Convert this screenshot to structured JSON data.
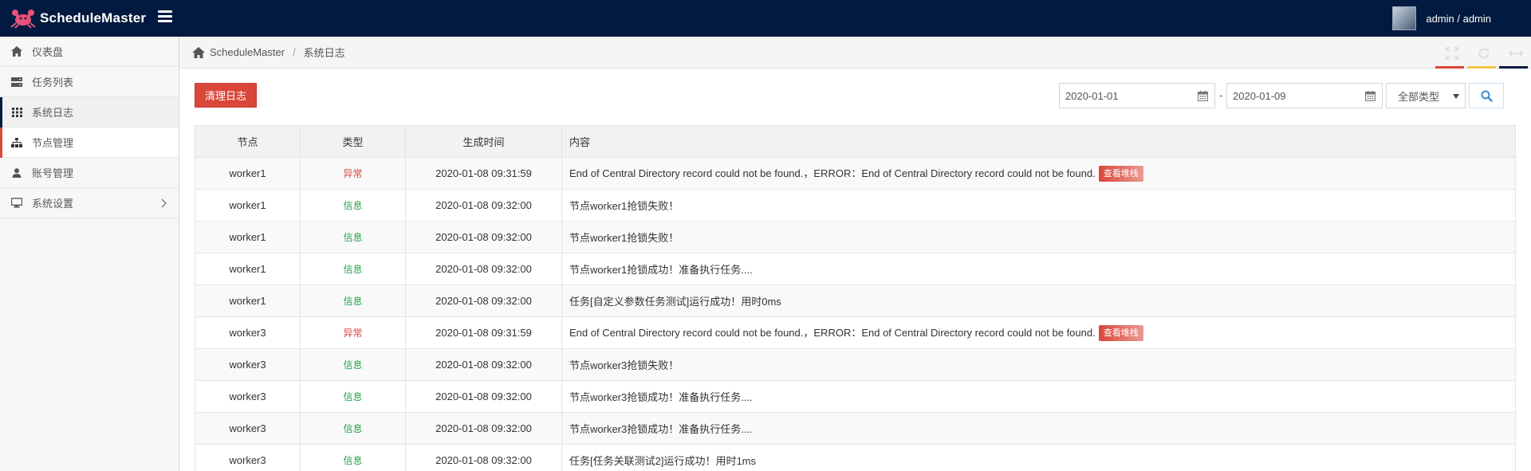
{
  "app": {
    "brand": "ScheduleMaster",
    "user": "admin / admin"
  },
  "colors": {
    "topbar": "#021a40",
    "accent_red": "#d9463a",
    "info_green": "#2aa04a",
    "line_red": "#d9463a",
    "line_yellow": "#f3c64a",
    "line_navy": "#021a40"
  },
  "sidebar": {
    "items": [
      {
        "label": "仪表盘",
        "icon": "home-icon"
      },
      {
        "label": "任务列表",
        "icon": "server-icon"
      },
      {
        "label": "系统日志",
        "icon": "grid-icon"
      },
      {
        "label": "节点管理",
        "icon": "sitemap-icon"
      },
      {
        "label": "账号管理",
        "icon": "user-icon"
      },
      {
        "label": "系统设置",
        "icon": "desktop-icon"
      }
    ]
  },
  "breadcrumb": {
    "root": "ScheduleMaster",
    "separator": "/",
    "current": "系统日志"
  },
  "toolbar": {
    "clear_label": "清理日志"
  },
  "filter": {
    "start_date": "2020-01-01",
    "end_date": "2020-01-09",
    "dash": "-",
    "type_selected": "全部类型"
  },
  "table": {
    "headers": [
      "节点",
      "类型",
      "生成时间",
      "内容"
    ],
    "stack_label": "查看堆栈",
    "rows": [
      {
        "node": "worker1",
        "type": "异常",
        "time": "2020-01-08 09:31:59",
        "content": "End of Central Directory record could not be found.，ERROR：End of Central Directory record could not be found."
      },
      {
        "node": "worker1",
        "type": "信息",
        "time": "2020-01-08 09:32:00",
        "content": "节点worker1抢锁失败！"
      },
      {
        "node": "worker1",
        "type": "信息",
        "time": "2020-01-08 09:32:00",
        "content": "节点worker1抢锁失败！"
      },
      {
        "node": "worker1",
        "type": "信息",
        "time": "2020-01-08 09:32:00",
        "content": "节点worker1抢锁成功！准备执行任务...."
      },
      {
        "node": "worker1",
        "type": "信息",
        "time": "2020-01-08 09:32:00",
        "content": "任务[自定义参数任务测试]运行成功！用时0ms"
      },
      {
        "node": "worker3",
        "type": "异常",
        "time": "2020-01-08 09:31:59",
        "content": "End of Central Directory record could not be found.，ERROR：End of Central Directory record could not be found."
      },
      {
        "node": "worker3",
        "type": "信息",
        "time": "2020-01-08 09:32:00",
        "content": "节点worker3抢锁失败！"
      },
      {
        "node": "worker3",
        "type": "信息",
        "time": "2020-01-08 09:32:00",
        "content": "节点worker3抢锁成功！准备执行任务...."
      },
      {
        "node": "worker3",
        "type": "信息",
        "time": "2020-01-08 09:32:00",
        "content": "节点worker3抢锁成功！准备执行任务...."
      },
      {
        "node": "worker3",
        "type": "信息",
        "time": "2020-01-08 09:32:00",
        "content": "任务[任务关联测试2]运行成功！用时1ms"
      }
    ]
  }
}
